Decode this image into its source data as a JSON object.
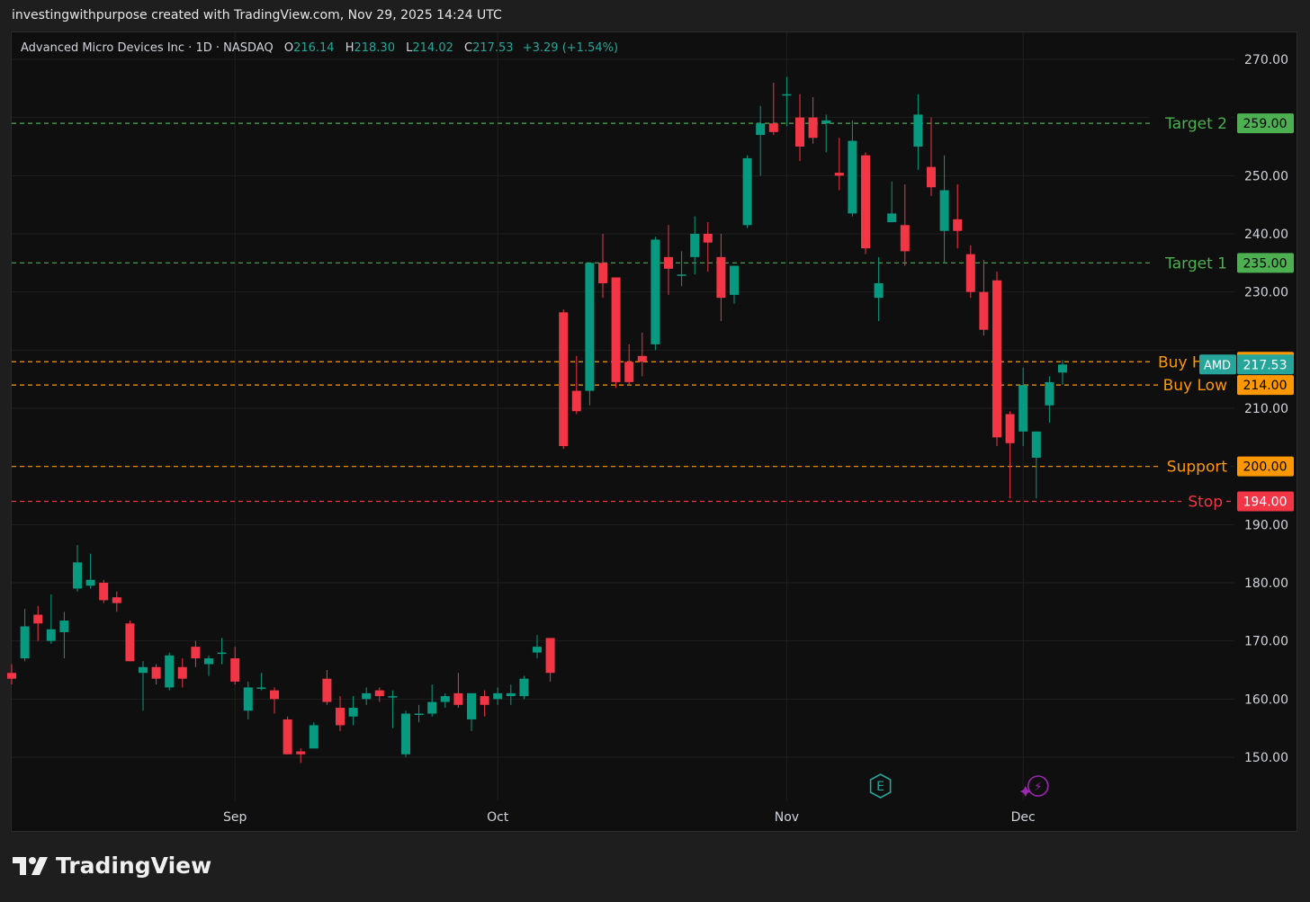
{
  "caption": "investingwithpurpose created with TradingView.com, Nov 29, 2025 14:24 UTC",
  "legend": {
    "name": "Advanced Micro Devices Inc · 1D · NASDAQ",
    "o_label": "O",
    "o": "216.14",
    "h_label": "H",
    "h": "218.30",
    "l_label": "L",
    "l": "214.02",
    "c_label": "C",
    "c": "217.53",
    "change": "+3.29 (+1.54%)"
  },
  "brand": {
    "name": "TradingView",
    "icon": "tradingview-logo-icon"
  },
  "colors": {
    "up": "#089981",
    "down": "#f23645",
    "target": "#4caf50",
    "buy": "#ff9800",
    "stop": "#f23645",
    "grid": "#1f1f1f",
    "axis_text": "#d1d4dc",
    "earnings": "#26a69a",
    "dividend": "#9c27b0"
  },
  "chart_data": {
    "type": "candlestick",
    "symbol": "AMD",
    "timeframe": "1D",
    "ylim": [
      143,
      273
    ],
    "y_ticks": [
      "270.00",
      "250.00",
      "240.00",
      "230.00",
      "210.00",
      "190.00",
      "180.00",
      "170.00",
      "160.00",
      "150.00"
    ],
    "x_labels": [
      {
        "label": "Sep",
        "bar": 17
      },
      {
        "label": "Oct",
        "bar": 37
      },
      {
        "label": "Nov",
        "bar": 59
      },
      {
        "label": "Dec",
        "bar": 77
      }
    ],
    "candles": [
      {
        "o": 164.5,
        "h": 166,
        "l": 162.5,
        "c": 163.5
      },
      {
        "o": 167,
        "h": 175.5,
        "l": 166.5,
        "c": 172.5
      },
      {
        "o": 174.5,
        "h": 176,
        "l": 170,
        "c": 173
      },
      {
        "o": 170,
        "h": 178,
        "l": 169.5,
        "c": 172
      },
      {
        "o": 171.5,
        "h": 175,
        "l": 167,
        "c": 173.5
      },
      {
        "o": 179,
        "h": 186.5,
        "l": 178.5,
        "c": 183.5
      },
      {
        "o": 179.5,
        "h": 185,
        "l": 179,
        "c": 180.5
      },
      {
        "o": 180,
        "h": 180.5,
        "l": 176.5,
        "c": 177
      },
      {
        "o": 177.5,
        "h": 178.5,
        "l": 175,
        "c": 176.5
      },
      {
        "o": 173,
        "h": 173.5,
        "l": 166.5,
        "c": 166.5
      },
      {
        "o": 164.5,
        "h": 166.5,
        "l": 158,
        "c": 165.5
      },
      {
        "o": 165.5,
        "h": 166,
        "l": 162.5,
        "c": 163.5
      },
      {
        "o": 162,
        "h": 168,
        "l": 161.5,
        "c": 167.5
      },
      {
        "o": 165.5,
        "h": 167,
        "l": 162,
        "c": 163.5
      },
      {
        "o": 169,
        "h": 170,
        "l": 165.5,
        "c": 167
      },
      {
        "o": 166,
        "h": 167.5,
        "l": 164,
        "c": 167
      },
      {
        "o": 168,
        "h": 170.5,
        "l": 166,
        "c": 168
      },
      {
        "o": 167,
        "h": 169,
        "l": 162.5,
        "c": 163
      },
      {
        "o": 158,
        "h": 163,
        "l": 156.5,
        "c": 162
      },
      {
        "o": 162,
        "h": 164.5,
        "l": 161.5,
        "c": 162
      },
      {
        "o": 161.5,
        "h": 162,
        "l": 157.5,
        "c": 160
      },
      {
        "o": 156.5,
        "h": 157,
        "l": 150.5,
        "c": 150.5
      },
      {
        "o": 151,
        "h": 151.5,
        "l": 149,
        "c": 150.5
      },
      {
        "o": 151.5,
        "h": 156,
        "l": 151.5,
        "c": 155.5
      },
      {
        "o": 163.5,
        "h": 165,
        "l": 159,
        "c": 159.5
      },
      {
        "o": 158.5,
        "h": 160.5,
        "l": 154.5,
        "c": 155.5
      },
      {
        "o": 157,
        "h": 160.5,
        "l": 155.5,
        "c": 158.5
      },
      {
        "o": 160,
        "h": 162,
        "l": 159,
        "c": 161
      },
      {
        "o": 161.5,
        "h": 162,
        "l": 159.5,
        "c": 160.5
      },
      {
        "o": 160.5,
        "h": 161.5,
        "l": 155,
        "c": 160.5
      },
      {
        "o": 150.5,
        "h": 158,
        "l": 150,
        "c": 157.5
      },
      {
        "o": 157.5,
        "h": 159,
        "l": 156,
        "c": 157.5
      },
      {
        "o": 157.5,
        "h": 162.5,
        "l": 157,
        "c": 159.5
      },
      {
        "o": 159.5,
        "h": 161,
        "l": 158.5,
        "c": 160.5
      },
      {
        "o": 161,
        "h": 164.5,
        "l": 158.5,
        "c": 159
      },
      {
        "o": 156.5,
        "h": 161,
        "l": 154.5,
        "c": 161
      },
      {
        "o": 160.5,
        "h": 161.5,
        "l": 157,
        "c": 159
      },
      {
        "o": 160,
        "h": 162,
        "l": 159,
        "c": 161
      },
      {
        "o": 160.5,
        "h": 162.5,
        "l": 159,
        "c": 161
      },
      {
        "o": 160.5,
        "h": 164,
        "l": 160,
        "c": 163.5
      },
      {
        "o": 168,
        "h": 171,
        "l": 167,
        "c": 169
      },
      {
        "o": 170.5,
        "h": 170.5,
        "l": 163,
        "c": 164.5
      },
      {
        "o": 226.5,
        "h": 227,
        "l": 203,
        "c": 203.5
      },
      {
        "o": 213,
        "h": 219,
        "l": 209,
        "c": 209.5
      },
      {
        "o": 213,
        "h": 235,
        "l": 210.5,
        "c": 235
      },
      {
        "o": 235,
        "h": 240,
        "l": 229,
        "c": 231.5
      },
      {
        "o": 232.5,
        "h": 232.5,
        "l": 213.5,
        "c": 214.5
      },
      {
        "o": 218,
        "h": 221,
        "l": 214,
        "c": 214.5
      },
      {
        "o": 219,
        "h": 223,
        "l": 215.5,
        "c": 218
      },
      {
        "o": 221,
        "h": 239.5,
        "l": 220,
        "c": 239
      },
      {
        "o": 236,
        "h": 241.5,
        "l": 229.5,
        "c": 234
      },
      {
        "o": 233,
        "h": 237,
        "l": 231,
        "c": 233
      },
      {
        "o": 236,
        "h": 243,
        "l": 233,
        "c": 240
      },
      {
        "o": 240,
        "h": 242,
        "l": 233.5,
        "c": 238.5
      },
      {
        "o": 236,
        "h": 240,
        "l": 225,
        "c": 229
      },
      {
        "o": 229.5,
        "h": 234.5,
        "l": 228,
        "c": 234.5
      },
      {
        "o": 241.5,
        "h": 253.5,
        "l": 241,
        "c": 253
      },
      {
        "o": 257,
        "h": 262,
        "l": 250,
        "c": 259
      },
      {
        "o": 259,
        "h": 266,
        "l": 257,
        "c": 257.5
      },
      {
        "o": 264,
        "h": 267,
        "l": 258.5,
        "c": 264
      },
      {
        "o": 260,
        "h": 264,
        "l": 252.5,
        "c": 255
      },
      {
        "o": 260,
        "h": 263.5,
        "l": 255.5,
        "c": 256.5
      },
      {
        "o": 259,
        "h": 260.5,
        "l": 254,
        "c": 259.5
      },
      {
        "o": 250.5,
        "h": 256.5,
        "l": 247.5,
        "c": 250
      },
      {
        "o": 243.5,
        "h": 259.5,
        "l": 243,
        "c": 256
      },
      {
        "o": 253.5,
        "h": 254,
        "l": 236.5,
        "c": 237.5
      },
      {
        "o": 229,
        "h": 236,
        "l": 225,
        "c": 231.5
      },
      {
        "o": 242,
        "h": 249,
        "l": 242,
        "c": 243.5
      },
      {
        "o": 241.5,
        "h": 248.5,
        "l": 234.5,
        "c": 237
      },
      {
        "o": 255,
        "h": 264,
        "l": 251,
        "c": 260.5
      },
      {
        "o": 251.5,
        "h": 260,
        "l": 246.5,
        "c": 248
      },
      {
        "o": 240.5,
        "h": 253.5,
        "l": 235,
        "c": 247.5
      },
      {
        "o": 242.5,
        "h": 248.5,
        "l": 237.5,
        "c": 240.5
      },
      {
        "o": 236.5,
        "h": 238,
        "l": 229,
        "c": 230
      },
      {
        "o": 230,
        "h": 235.5,
        "l": 222.5,
        "c": 223.5
      },
      {
        "o": 232,
        "h": 233.5,
        "l": 203.5,
        "c": 205
      },
      {
        "o": 209,
        "h": 209.5,
        "l": 194.5,
        "c": 204
      },
      {
        "o": 206,
        "h": 217,
        "l": 203.5,
        "c": 214
      },
      {
        "o": 201.5,
        "h": 206,
        "l": 194.5,
        "c": 206
      },
      {
        "o": 210.5,
        "h": 215.5,
        "l": 207.5,
        "c": 214.5
      },
      {
        "o": 216.14,
        "h": 218.3,
        "l": 214.02,
        "c": 217.53
      }
    ],
    "levels": [
      {
        "name": "Target 2",
        "value": 259.0,
        "label": "259.00",
        "kind": "target"
      },
      {
        "name": "Target 1",
        "value": 235.0,
        "label": "235.00",
        "kind": "target"
      },
      {
        "name": "Buy High",
        "value": 218.0,
        "label": "218.00",
        "kind": "buy"
      },
      {
        "name": "Buy Low",
        "value": 214.0,
        "label": "214.00",
        "kind": "buy"
      },
      {
        "name": "Support",
        "value": 200.0,
        "label": "200.00",
        "kind": "buy"
      },
      {
        "name": "Stop",
        "value": 194.0,
        "label": "194.00",
        "kind": "stop"
      }
    ],
    "last_price": {
      "symbol": "AMD",
      "value": 217.53,
      "label": "217.53"
    },
    "events": [
      {
        "type": "earnings",
        "glyph": "E",
        "bar": 66
      },
      {
        "type": "dividend",
        "glyph": "⚡",
        "bar": 78
      }
    ]
  }
}
